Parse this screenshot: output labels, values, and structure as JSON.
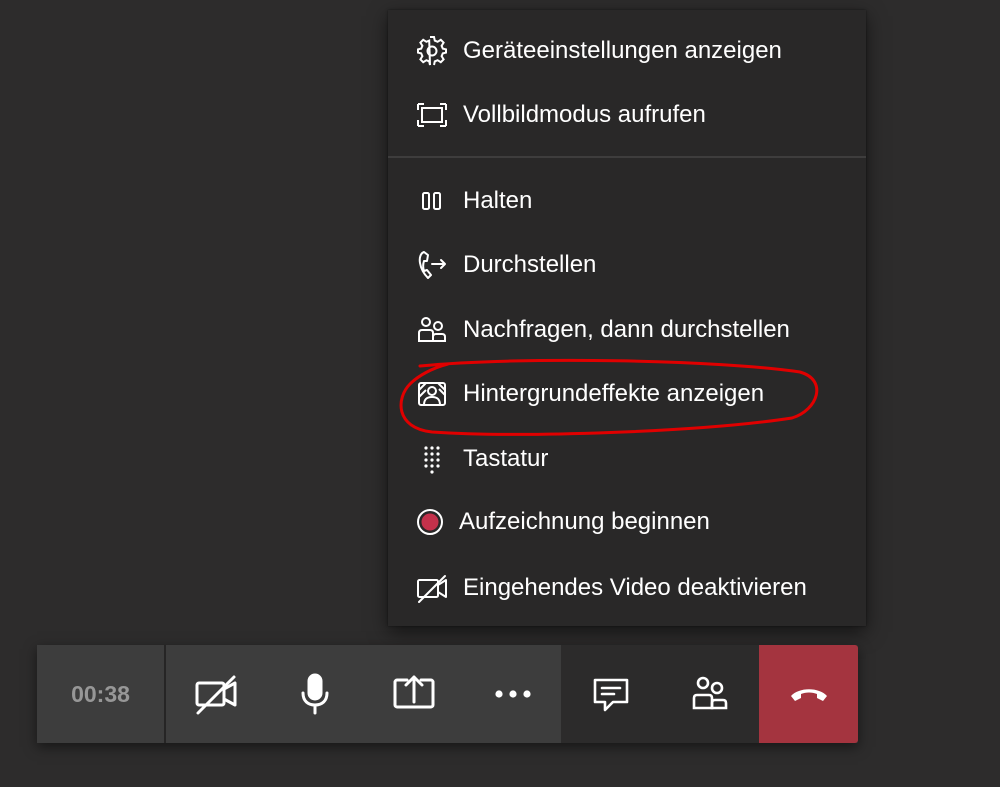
{
  "menu": {
    "items": [
      {
        "label": "Geräteeinstellungen anzeigen",
        "icon": "gear-icon"
      },
      {
        "label": "Vollbildmodus aufrufen",
        "icon": "fullscreen-icon"
      },
      {
        "label": "Halten",
        "icon": "pause-icon"
      },
      {
        "label": "Durchstellen",
        "icon": "phone-transfer-icon"
      },
      {
        "label": "Nachfragen, dann durchstellen",
        "icon": "people-icon"
      },
      {
        "label": "Hintergrundeffekte anzeigen",
        "icon": "background-effects-icon"
      },
      {
        "label": "Tastatur",
        "icon": "dialpad-icon"
      },
      {
        "label": "Aufzeichnung beginnen",
        "icon": "record-icon"
      },
      {
        "label": "Eingehendes Video deaktivieren",
        "icon": "video-off-icon"
      }
    ]
  },
  "toolbar": {
    "timer": "00:38",
    "buttons": [
      {
        "name": "camera-off-button",
        "icon": "camera-off-icon"
      },
      {
        "name": "microphone-button",
        "icon": "microphone-icon"
      },
      {
        "name": "share-screen-button",
        "icon": "share-screen-icon"
      },
      {
        "name": "more-actions-button",
        "icon": "more-icon"
      },
      {
        "name": "chat-button",
        "icon": "chat-icon"
      },
      {
        "name": "participants-button",
        "icon": "participants-icon"
      },
      {
        "name": "hang-up-button",
        "icon": "phone-hang-up-icon"
      }
    ]
  },
  "colors": {
    "background": "#2d2c2c",
    "menu_background": "#292828",
    "toolbar_background": "#3d3d3d",
    "hangup_red": "#a4343f",
    "record_dot": "#c4314b",
    "annotation_red": "#e00000"
  }
}
